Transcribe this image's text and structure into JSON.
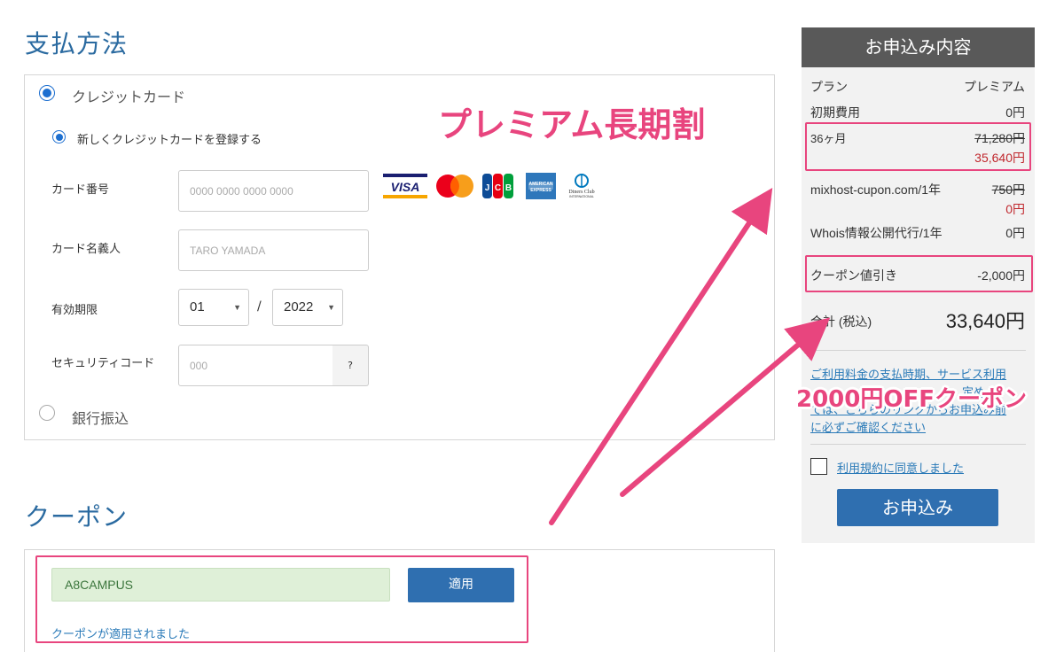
{
  "payment": {
    "title": "支払方法",
    "credit_card_label": "クレジットカード",
    "new_card_label": "新しくクレジットカードを登録する",
    "card_number_label": "カード番号",
    "card_number_placeholder": "0000 0000 0000 0000",
    "card_holder_label": "カード名義人",
    "card_holder_placeholder": "TARO YAMADA",
    "expiry_label": "有効期限",
    "expiry_month": "01",
    "expiry_separator": "/",
    "expiry_year": "2022",
    "security_code_label": "セキュリティコード",
    "security_code_placeholder": "000",
    "security_help": "?",
    "bank_transfer_label": "銀行振込",
    "card_brands": [
      "VISA",
      "Mastercard",
      "JCB",
      "American Express",
      "Diners Club"
    ]
  },
  "coupon": {
    "title": "クーポン",
    "code_value": "A8CAMPUS",
    "apply_label": "適用",
    "applied_message": "クーポンが適用されました"
  },
  "summary": {
    "header": "お申込み内容",
    "plan_label": "プラン",
    "plan_value": "プレミアム",
    "setup_label": "初期費用",
    "setup_value": "0円",
    "term_label": "36ヶ月",
    "term_original": "71,280円",
    "term_price": "35,640円",
    "domain_label": "mixhost-cupon.com/1年",
    "domain_original": "750円",
    "domain_price": "0円",
    "whois_label": "Whois情報公開代行/1年",
    "whois_value": "0円",
    "discount_label": "クーポン値引き",
    "discount_value": "-2,000円",
    "total_label": "合計 (税込)",
    "total_value": "33,640円",
    "notice_line1": "ご利用料金の支払時期、サービス利用",
    "notice_line2": "定め",
    "notice_line3": "では、こちらのリンクからお申込み前",
    "notice_line4": "に必ずご確認ください",
    "agree_label": "利用規約に同意しました",
    "submit_label": "お申込み"
  },
  "annotations": {
    "premium": "プレミアム長期割",
    "coupon_off": "2000円OFFクーポン"
  },
  "colors": {
    "accent": "#e8457e",
    "primary_button": "#2f6fb0",
    "title_blue": "#2a6aa0",
    "sidebar_header": "#595959"
  }
}
